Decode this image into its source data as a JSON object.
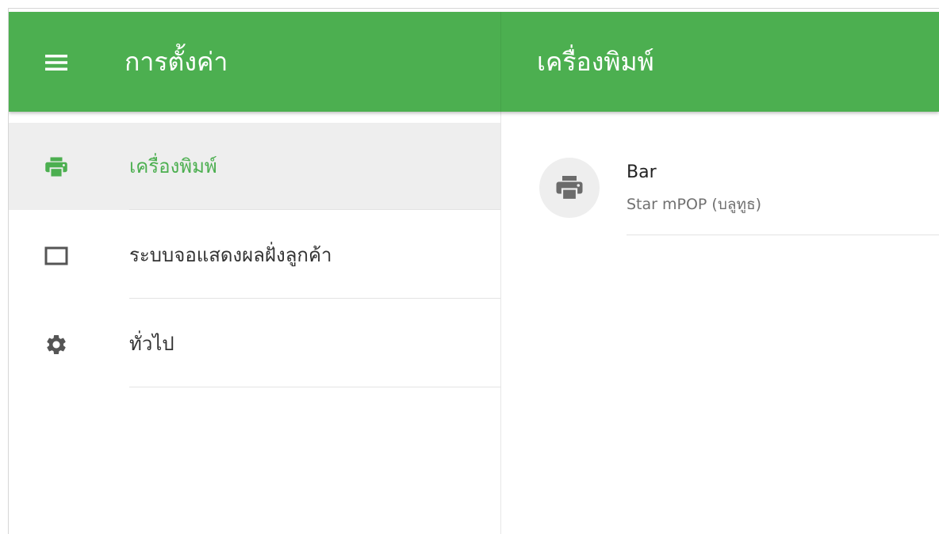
{
  "appbar": {
    "left_title": "การตั้งค่า",
    "right_title": "เครื่องพิมพ์",
    "menu_icon": "hamburger-menu-icon",
    "color": "#4caf50"
  },
  "sidebar": {
    "items": [
      {
        "label": "เครื่องพิมพ์",
        "icon": "printer-icon",
        "active": true
      },
      {
        "label": "ระบบจอแสดงผลฝั่งลูกค้า",
        "icon": "display-icon",
        "active": false
      },
      {
        "label": "ทั่วไป",
        "icon": "gear-icon",
        "active": false
      }
    ],
    "active_color": "#4caf50"
  },
  "printers": [
    {
      "name": "Bar",
      "model": "Star mPOP (บลูทูธ)",
      "icon": "printer-icon"
    }
  ]
}
